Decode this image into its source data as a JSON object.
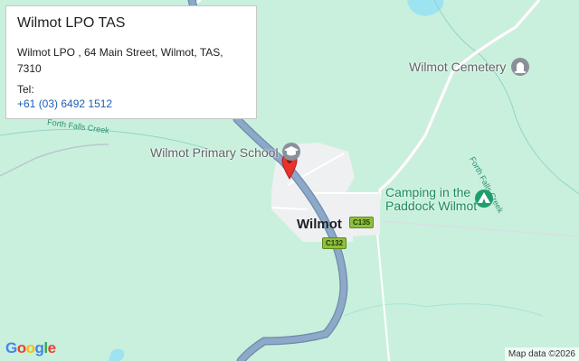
{
  "info_window": {
    "title": "Wilmot LPO TAS",
    "address": "Wilmot LPO , 64 Main Street, Wilmot, TAS, 7310",
    "tel_label": "Tel:",
    "phone": "+61 (03) 6492 1512"
  },
  "places": {
    "town": "Wilmot",
    "school": "Wilmot Primary School",
    "cemetery": "Wilmot Cemetery",
    "camping_line1": "Camping in the",
    "camping_line2": "Paddock Wilmot",
    "creek_west": "Forth Falls Creek",
    "creek_east": "Forth Falls Creek"
  },
  "road_shields": {
    "c135": "C135",
    "c132": "C132"
  },
  "map_footer": {
    "logo": "Google",
    "attribution": "Map data ©2026"
  },
  "colors": {
    "land": "#c9f0dc",
    "water": "#9ee3f2",
    "main_road": "#8ea8c7",
    "minor_road": "#ffffff",
    "marker": "#e8322c",
    "poi_icon": "#8a9099",
    "camping_icon": "#1e9e6a"
  },
  "icons": {
    "school": "graduation-cap-icon",
    "cemetery": "cemetery-icon",
    "camping": "tent-icon",
    "marker": "map-pin-icon"
  }
}
